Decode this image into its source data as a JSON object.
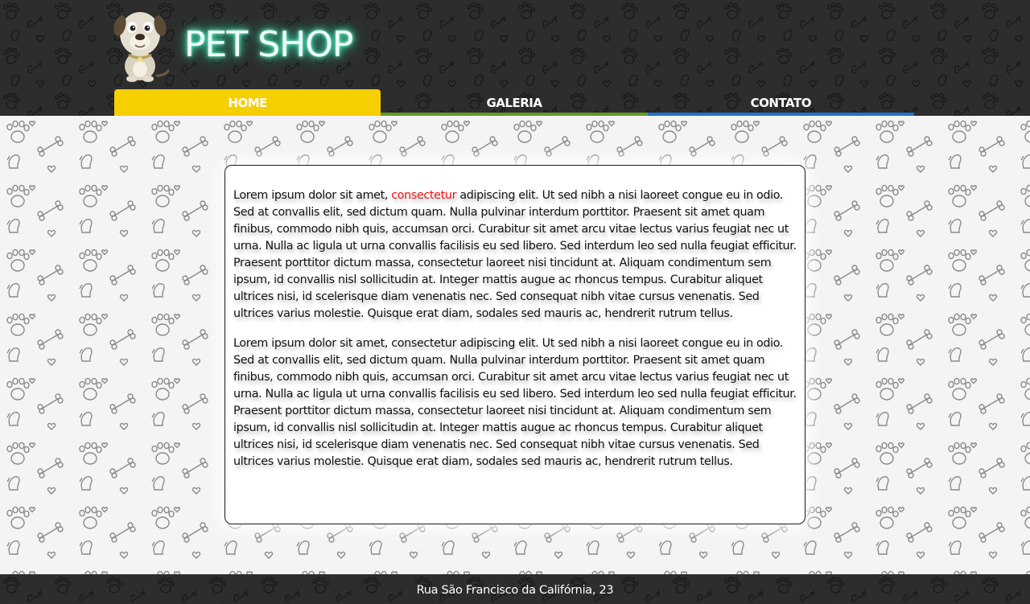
{
  "header": {
    "title": "PET SHOP",
    "logo_icon": "cartoon-dog-logo"
  },
  "nav": {
    "items": [
      {
        "label": "HOME",
        "state": "active",
        "color": "#f6cf00"
      },
      {
        "label": "GALERIA",
        "state": "inactive",
        "color": "#5e9e1c"
      },
      {
        "label": "CONTATO",
        "state": "inactive",
        "color": "#1e73d2"
      }
    ]
  },
  "content": {
    "paragraph_1": {
      "before": "Lorem ipsum dolor sit amet, ",
      "highlight": "consectetur",
      "after": " adipiscing elit. Ut sed nibh a nisi laoreet congue eu in odio. Sed at convallis elit, sed dictum quam. Nulla pulvinar interdum porttitor. Praesent sit amet quam finibus, commodo nibh quis, accumsan orci. Curabitur sit amet arcu vitae lectus varius feugiat nec ut urna. Nulla ac ligula ut urna convallis facilisis eu sed libero. Sed interdum leo sed nulla feugiat efficitur. Praesent porttitor dictum massa, consectetur laoreet nisi tincidunt at. Aliquam condimentum sem ipsum, id convallis nisl sollicitudin at. Integer mattis augue ac rhoncus tempus. Curabitur aliquet ultrices nisi, id scelerisque diam venenatis nec. Sed consequat nibh vitae cursus venenatis. Sed ultrices varius molestie. Quisque erat diam, sodales sed mauris ac, hendrerit rutrum tellus."
    },
    "paragraph_2": "Lorem ipsum dolor sit amet, consectetur adipiscing elit. Ut sed nibh a nisi laoreet congue eu in odio. Sed at convallis elit, sed dictum quam. Nulla pulvinar interdum porttitor. Praesent sit amet quam finibus, commodo nibh quis, accumsan orci. Curabitur sit amet arcu vitae lectus varius feugiat nec ut urna. Nulla ac ligula ut urna convallis facilisis eu sed libero. Sed interdum leo sed nulla feugiat efficitur. Praesent porttitor dictum massa, consectetur laoreet nisi tincidunt at. Aliquam condimentum sem ipsum, id convallis nisl sollicitudin at. Integer mattis augue ac rhoncus tempus. Curabitur aliquet ultrices nisi, id scelerisque diam venenatis nec. Sed consequat nibh vitae cursus venenatis. Sed ultrices varius molestie. Quisque erat diam, sodales sed mauris ac, hendrerit rutrum tellus."
  },
  "footer": {
    "address": "Rua São Francisco da Califórnia, 23"
  },
  "theme": {
    "header_bg": "#2d2d2d",
    "title_glow": "#3ff2b8",
    "highlight": "#ee1111",
    "pattern_icons": [
      "paw-print-icon",
      "bone-icon",
      "heart-icon",
      "sitting-dog-icon"
    ]
  }
}
